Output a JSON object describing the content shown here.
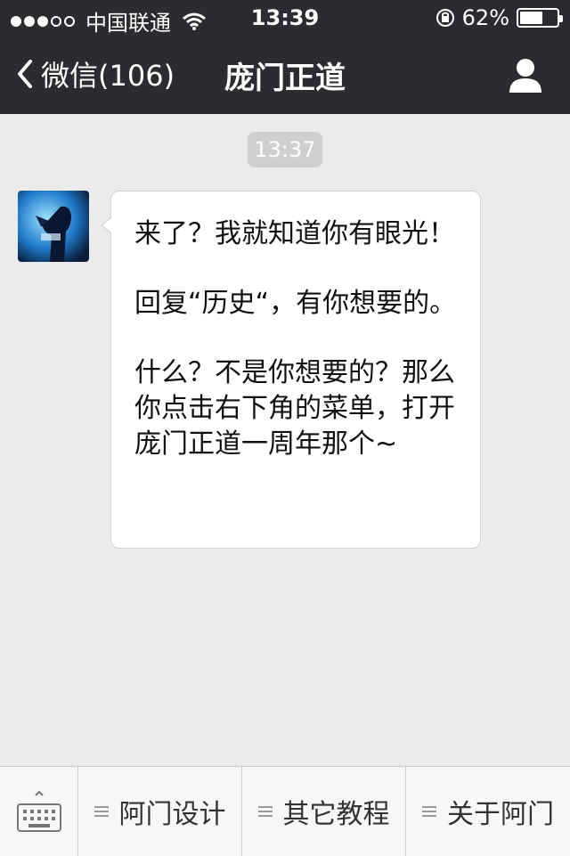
{
  "status": {
    "carrier": "中国联通",
    "time": "13:39",
    "battery": "62%",
    "battery_level": 0.62
  },
  "nav": {
    "back_label": "微信(106)",
    "title": "庞门正道"
  },
  "chat": {
    "timestamp": "13:37",
    "message_lines": [
      "来了？我就知道你有眼光！",
      "回复“历史“，有你想要的。",
      "什么？不是你想要的？那么你点击右下角的菜单，打开庞门正道一周年那个~"
    ]
  },
  "menu": {
    "items": [
      "阿门设计",
      "其它教程",
      "关于阿门"
    ]
  },
  "colors": {
    "nav_bg": "#2b2c30",
    "chat_bg": "#ebebeb",
    "bubble_bg": "#ffffff",
    "timestamp_bg": "#cfcfcf",
    "bottom_bg": "#f7f7f7"
  },
  "icons": [
    "wifi-icon",
    "orientation-lock-icon",
    "battery-icon",
    "back-chevron-icon",
    "profile-icon",
    "keyboard-icon",
    "menu-icon"
  ]
}
